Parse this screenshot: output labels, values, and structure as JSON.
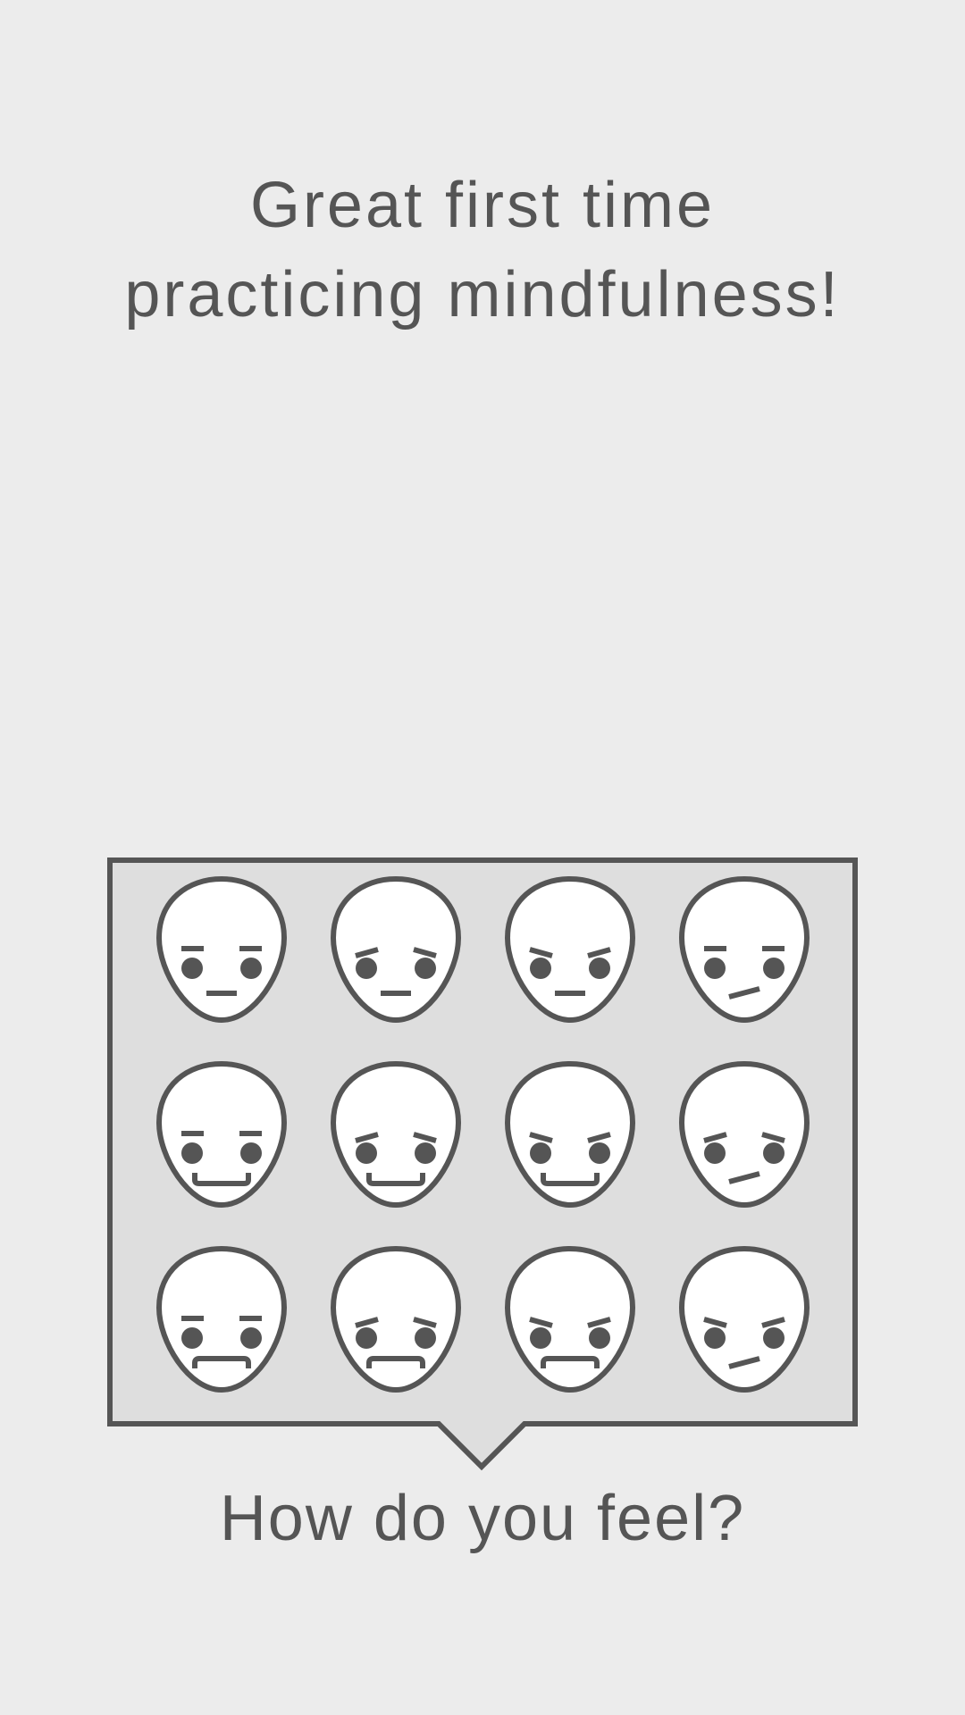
{
  "headline": {
    "line1": "Great first time",
    "line2": "practicing mindfulness!"
  },
  "mood_picker": {
    "prompt": "How do you feel?",
    "faces": [
      {
        "name": "neutral-neutral-face-icon",
        "brows": "flat",
        "mouth": "flat"
      },
      {
        "name": "sad-brows-neutral-face-icon",
        "brows": "sad",
        "mouth": "flat"
      },
      {
        "name": "angry-brows-neutral-face-icon",
        "brows": "angry",
        "mouth": "flat"
      },
      {
        "name": "neutral-brows-skeptical-face-icon",
        "brows": "flat",
        "mouth": "tilt"
      },
      {
        "name": "neutral-brows-smile-face-icon",
        "brows": "flat",
        "mouth": "smile"
      },
      {
        "name": "sad-brows-smile-face-icon",
        "brows": "sad",
        "mouth": "smile"
      },
      {
        "name": "angry-brows-smile-face-icon",
        "brows": "angry",
        "mouth": "smile"
      },
      {
        "name": "sad-brows-skeptical-face-icon",
        "brows": "sad",
        "mouth": "tilt"
      },
      {
        "name": "neutral-brows-frown-face-icon",
        "brows": "flat",
        "mouth": "frown"
      },
      {
        "name": "sad-brows-frown-face-icon",
        "brows": "sad",
        "mouth": "frown"
      },
      {
        "name": "angry-brows-frown-face-icon",
        "brows": "angry",
        "mouth": "frown"
      },
      {
        "name": "angry-brows-skeptical-face-icon",
        "brows": "angry",
        "mouth": "tilt"
      }
    ]
  },
  "colors": {
    "background": "#ececec",
    "panel": "#dedede",
    "stroke": "#555555",
    "face": "#ffffff"
  }
}
